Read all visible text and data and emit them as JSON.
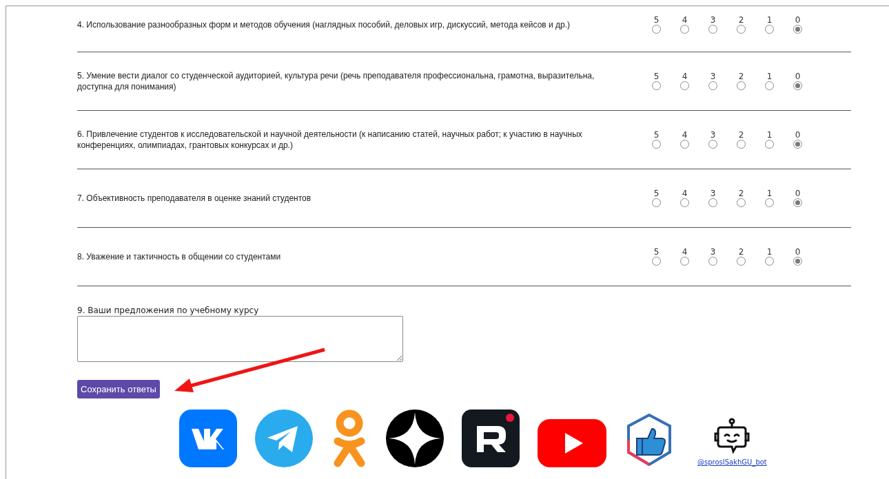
{
  "questions": [
    {
      "text": "4. Использование разнообразных форм и методов обучения (наглядных пособий, деловых игр, дискуссий, метода кейсов и др.)",
      "options": [
        {
          "label": "5",
          "selected": false
        },
        {
          "label": "4",
          "selected": false
        },
        {
          "label": "3",
          "selected": false
        },
        {
          "label": "2",
          "selected": false
        },
        {
          "label": "1",
          "selected": false
        },
        {
          "label": "0",
          "selected": true
        }
      ]
    },
    {
      "text": "5. Умение вести диалог со студенческой аудиторией, культура речи (речь преподавателя профессиональна, грамотна, выразительна, доступна для понимания)",
      "options": [
        {
          "label": "5",
          "selected": false
        },
        {
          "label": "4",
          "selected": false
        },
        {
          "label": "3",
          "selected": false
        },
        {
          "label": "2",
          "selected": false
        },
        {
          "label": "1",
          "selected": false
        },
        {
          "label": "0",
          "selected": true
        }
      ]
    },
    {
      "text": "6. Привлечение студентов к исследовательской и научной деятельности (к написанию статей, научных работ; к участию в научных конференциях, олимпиадах, грантовых конкурсах и др.)",
      "options": [
        {
          "label": "5",
          "selected": false
        },
        {
          "label": "4",
          "selected": false
        },
        {
          "label": "3",
          "selected": false
        },
        {
          "label": "2",
          "selected": false
        },
        {
          "label": "1",
          "selected": false
        },
        {
          "label": "0",
          "selected": true
        }
      ]
    },
    {
      "text": "7. Объективность преподавателя в оценке знаний студентов",
      "options": [
        {
          "label": "5",
          "selected": false
        },
        {
          "label": "4",
          "selected": false
        },
        {
          "label": "3",
          "selected": false
        },
        {
          "label": "2",
          "selected": false
        },
        {
          "label": "1",
          "selected": false
        },
        {
          "label": "0",
          "selected": true
        }
      ]
    },
    {
      "text": "8. Уважение и тактичность в общении со студентами",
      "options": [
        {
          "label": "5",
          "selected": false
        },
        {
          "label": "4",
          "selected": false
        },
        {
          "label": "3",
          "selected": false
        },
        {
          "label": "2",
          "selected": false
        },
        {
          "label": "1",
          "selected": false
        },
        {
          "label": "0",
          "selected": true
        }
      ]
    }
  ],
  "suggestion": {
    "label": "9. Ваши предложения по учебному курсу"
  },
  "submit_button": "Сохранить ответы",
  "social_links": [
    {
      "kind": "vk"
    },
    {
      "kind": "telegram"
    },
    {
      "kind": "ok"
    },
    {
      "kind": "dzen"
    },
    {
      "kind": "rutube"
    },
    {
      "kind": "youtube"
    },
    {
      "kind": "like"
    },
    {
      "kind": "bot",
      "caption": "@sprosISakhGU_bot"
    }
  ]
}
